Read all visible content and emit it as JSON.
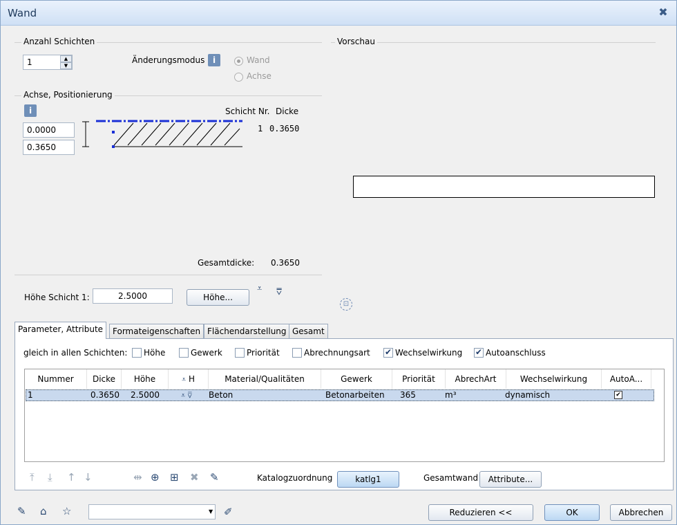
{
  "window": {
    "title": "Wand"
  },
  "layers": {
    "group_label": "Anzahl Schichten",
    "count_value": "1",
    "mode_label": "Änderungsmodus",
    "radio_wand": "Wand",
    "radio_achse": "Achse"
  },
  "axis": {
    "group_label": "Achse, Positionierung",
    "offset_top": "0.0000",
    "offset_bottom": "0.3650",
    "col_layer": "Schicht Nr.",
    "col_thickness": "Dicke",
    "row_layer": "1",
    "row_thickness": "0.3650",
    "total_label": "Gesamtdicke:",
    "total_value": "0.3650"
  },
  "height": {
    "label": "Höhe Schicht 1:",
    "value": "2.5000",
    "button": "Höhe..."
  },
  "preview": {
    "label": "Vorschau"
  },
  "tabs": [
    "Parameter, Attribute",
    "Formateigenschaften",
    "Flächendarstellung",
    "Gesamt"
  ],
  "same_all": {
    "label": "gleich in allen Schichten:",
    "options": [
      {
        "label": "Höhe",
        "checked": false
      },
      {
        "label": "Gewerk",
        "checked": false
      },
      {
        "label": "Priorität",
        "checked": false
      },
      {
        "label": "Abrechnungsart",
        "checked": false
      },
      {
        "label": "Wechselwirkung",
        "checked": true
      },
      {
        "label": "Autoanschluss",
        "checked": true
      }
    ]
  },
  "table": {
    "columns": [
      "Nummer",
      "Dicke",
      "Höhe",
      "H",
      "Material/Qualitäten",
      "Gewerk",
      "Priorität",
      "AbrechArt",
      "Wechselwirkung",
      "AutoA..."
    ],
    "rows": [
      {
        "nummer": "1",
        "dicke": "0.3650",
        "hoehe": "2.5000",
        "material": "Beton",
        "gewerk": "Betonarbeiten",
        "prioritaet": "365",
        "abrechart": "m³",
        "wechselwirkung": "dynamisch",
        "autoanschluss": true
      }
    ]
  },
  "catalog": {
    "label": "Katalogzuordnung",
    "button": "katlg1",
    "total_wall_label": "Gesamtwand",
    "attr_button": "Attribute..."
  },
  "footer": {
    "combo_value": "",
    "reduce": "Reduzieren <<",
    "ok": "OK",
    "cancel": "Abbrechen"
  }
}
